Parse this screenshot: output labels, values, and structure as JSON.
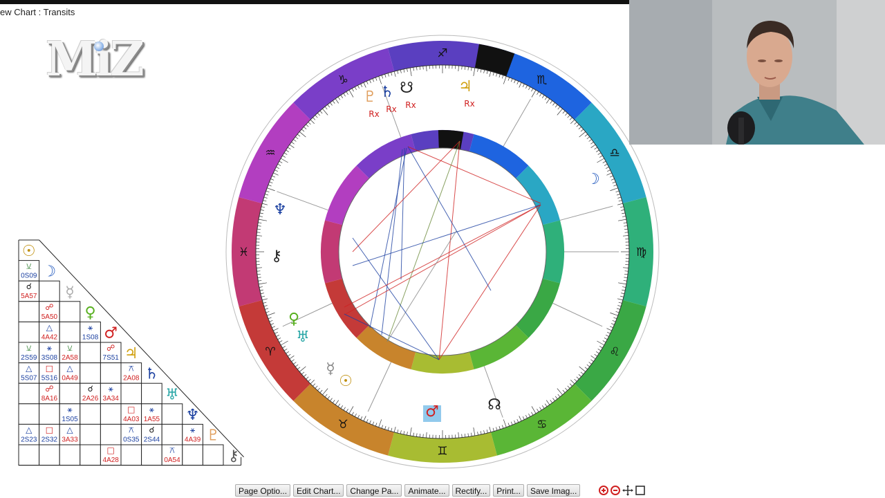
{
  "window": {
    "title": "ew Chart : Transits"
  },
  "logo": {
    "text": "MiZ"
  },
  "toolbar": {
    "buttons": [
      "Page Optio...",
      "Edit Chart...",
      "Change Pa...",
      "Animate...",
      "Rectify...",
      "Print...",
      "Save Imag..."
    ]
  },
  "tools": {
    "zoom_in": "zoom-in-icon",
    "zoom_out": "zoom-out-icon",
    "pan": "pan-icon",
    "fit": "fit-icon"
  },
  "chart": {
    "outer_signs": [
      {
        "glyph": "♐",
        "color": "#5a3fc0"
      },
      {
        "glyph": "♏",
        "color": "#1e64e0"
      },
      {
        "glyph": "♎",
        "color": "#2aa7c4"
      },
      {
        "glyph": "♍",
        "color": "#2fb07a"
      },
      {
        "glyph": "♌",
        "color": "#3aa845"
      },
      {
        "glyph": "♋",
        "color": "#5ab636"
      },
      {
        "glyph": "♊",
        "color": "#a8bc32"
      },
      {
        "glyph": "♉",
        "color": "#c8842c"
      },
      {
        "glyph": "♈",
        "color": "#c43a38"
      },
      {
        "glyph": "♓",
        "color": "#c23a74"
      },
      {
        "glyph": "♒",
        "color": "#b23ec0"
      },
      {
        "glyph": "♑",
        "color": "#7a3ec8"
      }
    ],
    "outer_planets": [
      {
        "glyph": "♆",
        "label": "",
        "color": "#1a3fa0"
      },
      {
        "glyph": "⚷",
        "label": "",
        "color": "#222222"
      },
      {
        "glyph": "♀",
        "label": "",
        "color": "#58b020"
      },
      {
        "glyph": "♅",
        "label": "",
        "color": "#2aa7a7"
      },
      {
        "glyph": "☿",
        "label": "",
        "color": "#888888"
      },
      {
        "glyph": "☉",
        "label": "",
        "color": "#c09010"
      },
      {
        "glyph": "♂",
        "label": "",
        "color": "#d02020"
      },
      {
        "glyph": "☊",
        "label": "",
        "color": "#222222"
      },
      {
        "glyph": "☽",
        "label": "",
        "color": "#2a5fc0"
      },
      {
        "glyph": "♃",
        "label": "Rx",
        "color": "#d0a010"
      },
      {
        "glyph": "☋",
        "label": "Rx",
        "color": "#222222"
      },
      {
        "glyph": "♄",
        "label": "Rx",
        "color": "#1a3fa0"
      },
      {
        "glyph": "♇",
        "label": "Rx",
        "color": "#e0a060"
      }
    ],
    "rx_label": "Rx"
  },
  "aspect_grid": {
    "planets": [
      {
        "glyph": "☉",
        "color": "#c09010"
      },
      {
        "glyph": "☽",
        "color": "#2a5fc0"
      },
      {
        "glyph": "☿",
        "color": "#aaaaaa"
      },
      {
        "glyph": "♀",
        "color": "#58b020"
      },
      {
        "glyph": "♂",
        "color": "#d02020"
      },
      {
        "glyph": "♃",
        "color": "#d0a010"
      },
      {
        "glyph": "♄",
        "color": "#1a3fa0"
      },
      {
        "glyph": "♅",
        "color": "#2aa7a7"
      },
      {
        "glyph": "♆",
        "color": "#1a3fa0"
      },
      {
        "glyph": "♇",
        "color": "#e0a060"
      },
      {
        "glyph": "⚷",
        "color": "#555555"
      }
    ],
    "cells": [
      {
        "r": 1,
        "c": 0,
        "sym": "⚺",
        "code": "0S09",
        "color": "#1a3fa0",
        "symcolor": "#2a7a2a"
      },
      {
        "r": 2,
        "c": 0,
        "sym": "☌",
        "code": "5A57",
        "color": "#d02020",
        "symcolor": "#111111"
      },
      {
        "r": 3,
        "c": 1,
        "sym": "☍",
        "code": "5A50",
        "color": "#d02020",
        "symcolor": "#d02020"
      },
      {
        "r": 4,
        "c": 1,
        "sym": "△",
        "code": "4A42",
        "color": "#d02020",
        "symcolor": "#1a3fa0"
      },
      {
        "r": 4,
        "c": 3,
        "sym": "⚹",
        "code": "1S08",
        "color": "#1a3fa0",
        "symcolor": "#1a3fa0"
      },
      {
        "r": 5,
        "c": 0,
        "sym": "⚺",
        "code": "2S59",
        "color": "#1a3fa0",
        "symcolor": "#2a7a2a"
      },
      {
        "r": 5,
        "c": 1,
        "sym": "⚹",
        "code": "3S08",
        "color": "#1a3fa0",
        "symcolor": "#1a3fa0"
      },
      {
        "r": 5,
        "c": 2,
        "sym": "⚺",
        "code": "2A58",
        "color": "#d02020",
        "symcolor": "#2a7a2a"
      },
      {
        "r": 5,
        "c": 4,
        "sym": "☍",
        "code": "7S51",
        "color": "#1a3fa0",
        "symcolor": "#d02020"
      },
      {
        "r": 6,
        "c": 0,
        "sym": "△",
        "code": "5S07",
        "color": "#1a3fa0",
        "symcolor": "#1a3fa0"
      },
      {
        "r": 6,
        "c": 1,
        "sym": "□",
        "code": "5S16",
        "color": "#1a3fa0",
        "symcolor": "#d02020"
      },
      {
        "r": 6,
        "c": 2,
        "sym": "△",
        "code": "0A49",
        "color": "#d02020",
        "symcolor": "#1a3fa0"
      },
      {
        "r": 6,
        "c": 5,
        "sym": "⚻",
        "code": "2A08",
        "color": "#d02020",
        "symcolor": "#1a3fa0"
      },
      {
        "r": 7,
        "c": 1,
        "sym": "☍",
        "code": "8A16",
        "color": "#d02020",
        "symcolor": "#d02020"
      },
      {
        "r": 7,
        "c": 3,
        "sym": "☌",
        "code": "2A26",
        "color": "#d02020",
        "symcolor": "#111111"
      },
      {
        "r": 7,
        "c": 4,
        "sym": "⚹",
        "code": "3A34",
        "color": "#d02020",
        "symcolor": "#1a3fa0"
      },
      {
        "r": 8,
        "c": 2,
        "sym": "⚹",
        "code": "1S05",
        "color": "#1a3fa0",
        "symcolor": "#1a3fa0"
      },
      {
        "r": 8,
        "c": 5,
        "sym": "□",
        "code": "4A03",
        "color": "#d02020",
        "symcolor": "#d02020"
      },
      {
        "r": 8,
        "c": 6,
        "sym": "⚹",
        "code": "1A55",
        "color": "#d02020",
        "symcolor": "#1a3fa0"
      },
      {
        "r": 9,
        "c": 0,
        "sym": "△",
        "code": "2S23",
        "color": "#1a3fa0",
        "symcolor": "#1a3fa0"
      },
      {
        "r": 9,
        "c": 1,
        "sym": "□",
        "code": "2S32",
        "color": "#1a3fa0",
        "symcolor": "#d02020"
      },
      {
        "r": 9,
        "c": 2,
        "sym": "△",
        "code": "3A33",
        "color": "#d02020",
        "symcolor": "#1a3fa0"
      },
      {
        "r": 9,
        "c": 5,
        "sym": "⚻",
        "code": "0S35",
        "color": "#1a3fa0",
        "symcolor": "#1a3fa0"
      },
      {
        "r": 9,
        "c": 6,
        "sym": "☌",
        "code": "2S44",
        "color": "#1a3fa0",
        "symcolor": "#111111"
      },
      {
        "r": 9,
        "c": 8,
        "sym": "⚹",
        "code": "4A39",
        "color": "#d02020",
        "symcolor": "#1a3fa0"
      },
      {
        "r": 10,
        "c": 4,
        "sym": "□",
        "code": "4A28",
        "color": "#d02020",
        "symcolor": "#d02020"
      },
      {
        "r": 10,
        "c": 7,
        "sym": "⚻",
        "code": "0A54",
        "color": "#d02020",
        "symcolor": "#1a3fa0"
      }
    ]
  }
}
